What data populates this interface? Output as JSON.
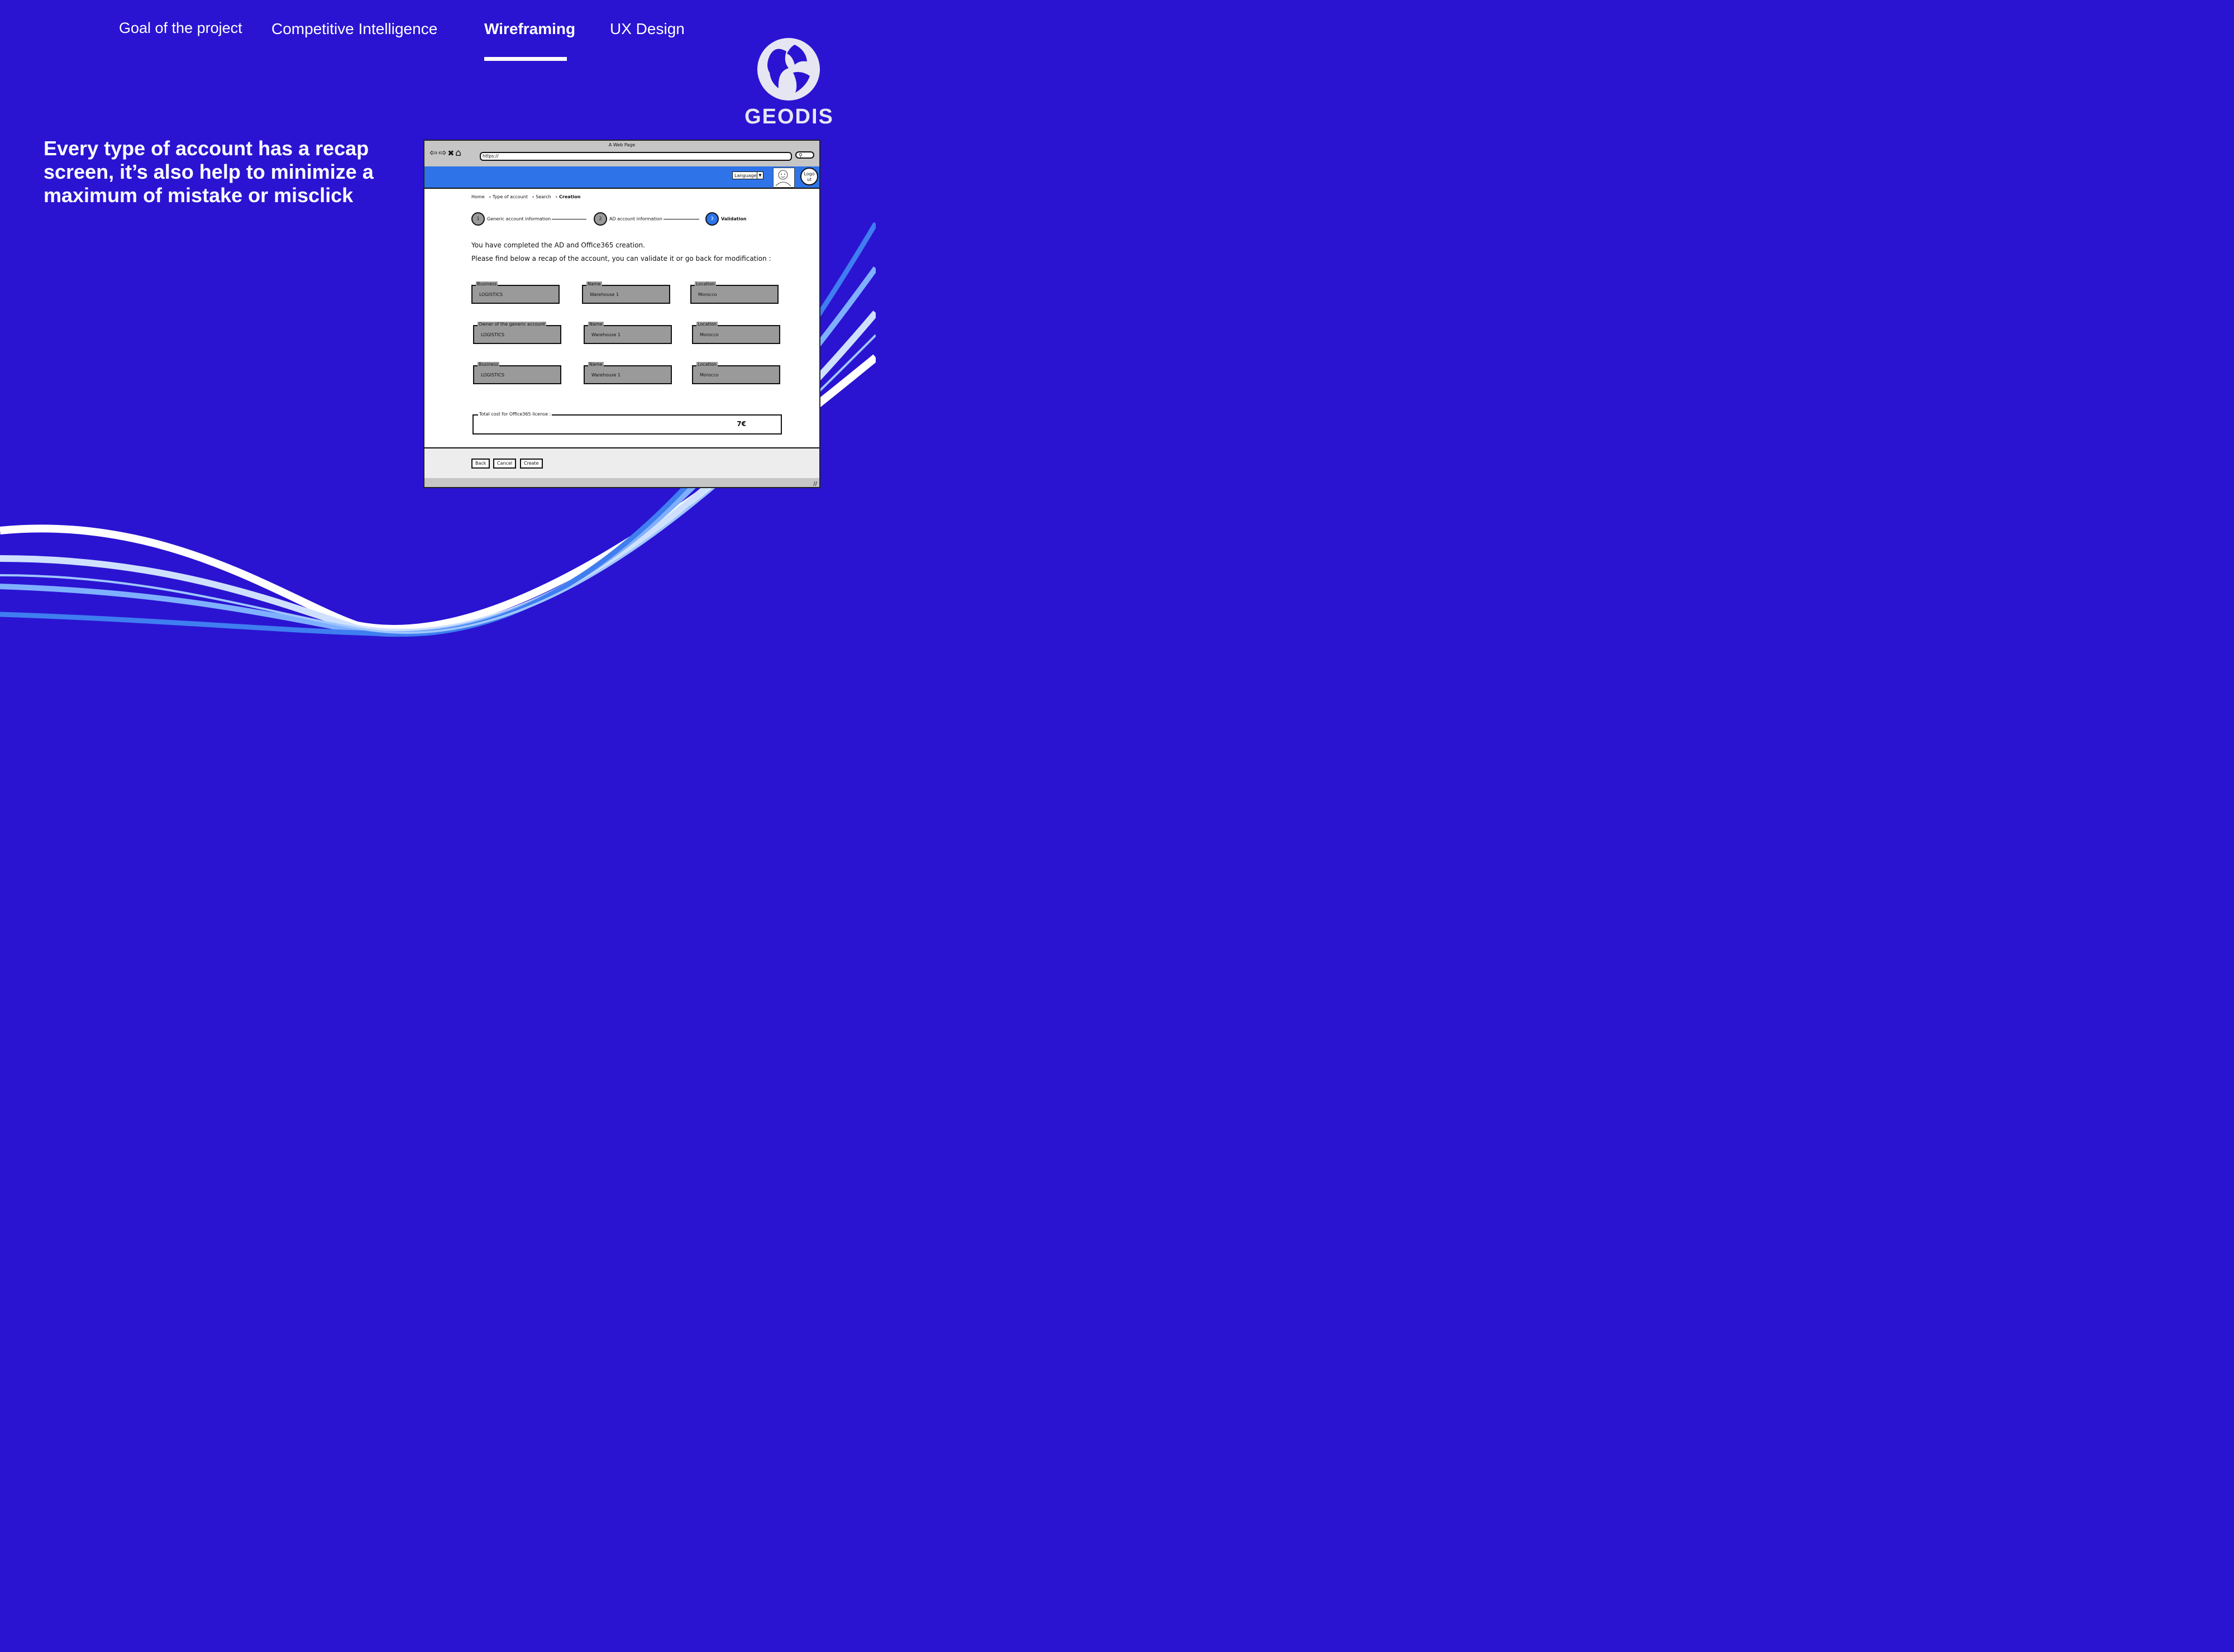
{
  "nav": {
    "items": [
      "Goal of the project",
      "Competitive Intelligence",
      "Wireframing",
      "UX Design"
    ],
    "active": "Wireframing"
  },
  "logo": {
    "text": "GEODIS"
  },
  "headline": "Every type of account has a recap screen, it’s also help to minimize a maximum of mistake or misclick",
  "colors": {
    "background": "#2a14d1",
    "wireframe_header": "#2e74e8",
    "field_fill": "#9a9a9a"
  },
  "wireframe": {
    "window_title": "A Web Page",
    "url": "https://",
    "icons": [
      "back-arrow-icon",
      "forward-arrow-icon",
      "close-icon",
      "home-icon",
      "search-icon"
    ],
    "language_label": "Language",
    "logout_label": "Logo ut",
    "breadcrumb": [
      "Home",
      "Type of account",
      "Search",
      "Creation"
    ],
    "steps": [
      {
        "number": "1",
        "label": "Generic account information"
      },
      {
        "number": "2",
        "label": "AD account information"
      },
      {
        "number": "3",
        "label": "Validation"
      }
    ],
    "message_line1": "You have completed the AD and Office365 creation.",
    "message_line2": "Please find below a recap of the account, you can validate it or go back for modification :",
    "fields": [
      {
        "label": "Business",
        "value": "LOGISTICS"
      },
      {
        "label": "Name",
        "value": "Warehouse 1"
      },
      {
        "label": "Location",
        "value": "Morocco"
      },
      {
        "label": "Owner of the generic account",
        "value": "LOGISTICS"
      },
      {
        "label": "Name",
        "value": "Warehouse 1"
      },
      {
        "label": "Location",
        "value": "Morocco"
      },
      {
        "label": "Business",
        "value": "LOGISTICS"
      },
      {
        "label": "Name",
        "value": "Warehouse 1"
      },
      {
        "label": "Location",
        "value": "Morocco"
      }
    ],
    "total_label": "Total cost for Office365 license :",
    "total_value": "7€",
    "buttons": {
      "back": "Back",
      "cancel": "Cancel",
      "create": "Create"
    }
  }
}
